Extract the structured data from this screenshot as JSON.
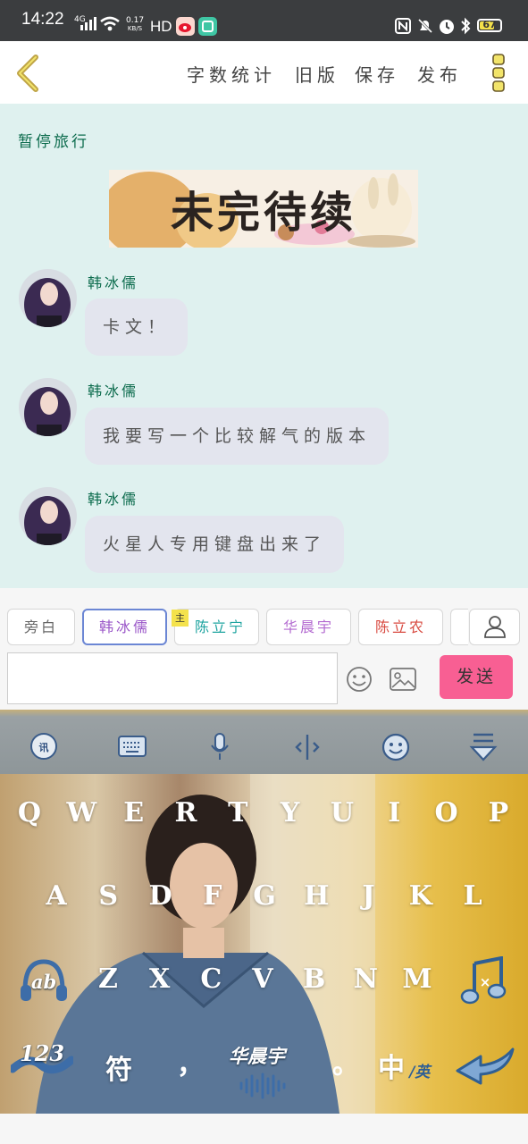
{
  "status_bar": {
    "time": "14:22",
    "network": "4G",
    "speed_value": "0.17",
    "speed_unit": "KB/S",
    "hd": "HD",
    "battery": "67"
  },
  "toolbar": {
    "word_count": "字数统计",
    "old_version": "旧版",
    "save": "保存",
    "publish": "发布"
  },
  "chat": {
    "chapter_title": "暂停旅行",
    "banner_text": "未完待续",
    "messages": [
      {
        "name": "韩冰儒",
        "text": "卡文！"
      },
      {
        "name": "韩冰儒",
        "text": "我要写一个比较解气的版本"
      },
      {
        "name": "韩冰儒",
        "text": "火星人专用键盘出来了"
      }
    ]
  },
  "roles": {
    "items": [
      {
        "label": "旁白",
        "color": "#666666"
      },
      {
        "label": "韩冰儒",
        "color": "#9a56c8"
      },
      {
        "label": "陈立宁",
        "color": "#1fa4a0"
      },
      {
        "label": "华晨宇",
        "color": "#b36ad0"
      },
      {
        "label": "陈立农",
        "color": "#d84a40"
      }
    ],
    "main_badge": "主",
    "selected_index": 1
  },
  "compose": {
    "input_value": "",
    "send_label": "发送",
    "send_color": "#f85f93"
  },
  "keyboard": {
    "toolbar_icons": [
      "xunfei-logo-icon",
      "keyboard-icon",
      "mic-icon",
      "cursor-move-icon",
      "emoji-icon",
      "collapse-keyboard-icon"
    ],
    "row1": [
      "Q",
      "W",
      "E",
      "R",
      "T",
      "Y",
      "U",
      "I",
      "O",
      "P"
    ],
    "row2": [
      "A",
      "S",
      "D",
      "F",
      "G",
      "H",
      "J",
      "K",
      "L"
    ],
    "row3": [
      "Z",
      "X",
      "C",
      "V",
      "B",
      "N",
      "M"
    ],
    "shift_label": "ab",
    "num_label": "123",
    "symbol_label": "符",
    "comma_label": "，",
    "space_label": "华晨宇",
    "period_label": "。",
    "lang_label": "中",
    "lang_sub_label": "/英"
  }
}
